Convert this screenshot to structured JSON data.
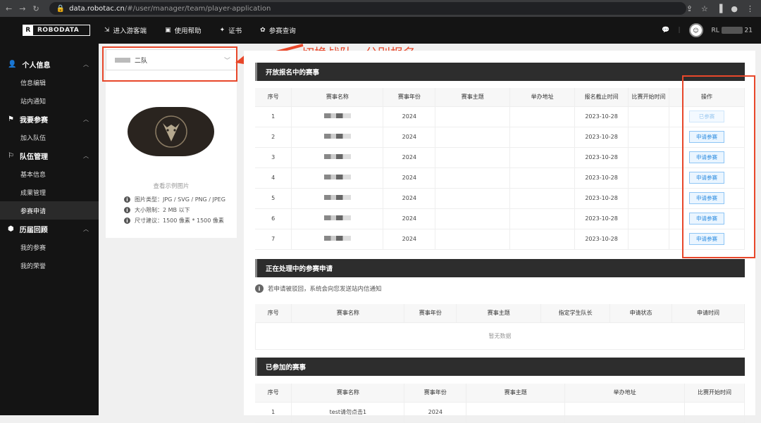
{
  "browser": {
    "url_host": "data.robotac.cn",
    "url_path": "/#/user/manager/team/player-application"
  },
  "topbar": {
    "logo": "ROBODATA",
    "nav": [
      {
        "label": "进入游客端",
        "icon": "enter-icon"
      },
      {
        "label": "使用帮助",
        "icon": "help-icon"
      },
      {
        "label": "证书",
        "icon": "certificate-icon"
      },
      {
        "label": "参赛查询",
        "icon": "gear-icon"
      }
    ],
    "user_prefix": "RL",
    "user_suffix": "21"
  },
  "sidebar": {
    "groups": [
      {
        "label": "个人信息",
        "icon": "person-icon",
        "items": [
          "信息编辑",
          "站内通知"
        ]
      },
      {
        "label": "我要参赛",
        "icon": "flag-icon",
        "items": [
          "加入队伍"
        ]
      },
      {
        "label": "队伍管理",
        "icon": "banner-icon",
        "items": [
          "基本信息",
          "成果管理",
          "参赛申请"
        ]
      },
      {
        "label": "历届回顾",
        "icon": "cube-icon",
        "items": [
          "我的参赛",
          "我的荣誉"
        ]
      }
    ],
    "active_item": "参赛申请"
  },
  "team_select": {
    "value": "二队"
  },
  "team_image": {
    "example_link": "查看示例图片",
    "hints": [
      "图片类型：JPG / SVG / PNG / JPEG",
      "大小限制：2 MB 以下",
      "尺寸建议：1500 像素 * 1500 像素"
    ]
  },
  "annotation": {
    "text": "切换战队，分别报名"
  },
  "open_section": {
    "title": "开放报名中的赛事",
    "headers": [
      "序号",
      "赛事名称",
      "赛事年份",
      "赛事主题",
      "举办地址",
      "报名截止时间",
      "比赛开始时间",
      "操作"
    ],
    "rows": [
      {
        "no": "1",
        "year": "2024",
        "deadline": "2023-10-28",
        "action": "已参赛",
        "disabled": true
      },
      {
        "no": "2",
        "year": "2024",
        "deadline": "2023-10-28",
        "action": "申请参赛",
        "disabled": false
      },
      {
        "no": "3",
        "year": "2024",
        "deadline": "2023-10-28",
        "action": "申请参赛",
        "disabled": false
      },
      {
        "no": "4",
        "year": "2024",
        "deadline": "2023-10-28",
        "action": "申请参赛",
        "disabled": false
      },
      {
        "no": "5",
        "year": "2024",
        "deadline": "2023-10-28",
        "action": "申请参赛",
        "disabled": false
      },
      {
        "no": "6",
        "year": "2024",
        "deadline": "2023-10-28",
        "action": "申请参赛",
        "disabled": false
      },
      {
        "no": "7",
        "year": "2024",
        "deadline": "2023-10-28",
        "action": "申请参赛",
        "disabled": false
      }
    ]
  },
  "processing_section": {
    "title": "正在处理中的参赛申请",
    "notice": "若申请被驳回，系统会向您发送站内信通知",
    "headers": [
      "序号",
      "赛事名称",
      "赛事年份",
      "赛事主题",
      "指定学生队长",
      "申请状态",
      "申请时间"
    ],
    "empty": "暂无数据"
  },
  "joined_section": {
    "title": "已参加的赛事",
    "headers": [
      "序号",
      "赛事名称",
      "赛事年份",
      "赛事主题",
      "举办地址",
      "比赛开始时间"
    ],
    "rows": [
      {
        "no": "1",
        "name": "test请勿点击1",
        "year": "2024"
      }
    ]
  }
}
